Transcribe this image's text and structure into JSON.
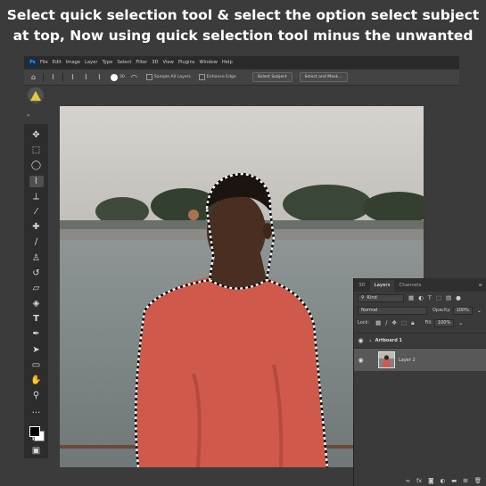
{
  "caption": {
    "line1": "Select quick selection tool & select the option select subject",
    "line2": "at top, Now using quick selection tool minus the unwanted"
  },
  "menubar": {
    "logo": "Ps",
    "items": [
      "File",
      "Edit",
      "Image",
      "Layer",
      "Type",
      "Select",
      "Filter",
      "3D",
      "View",
      "Plugins",
      "Window",
      "Help"
    ]
  },
  "options_bar": {
    "brush_size": "30",
    "sample_all_layers": "Sample All Layers",
    "enhance_edge": "Enhance Edge",
    "select_subject": "Select Subject",
    "select_and_mask": "Select and Mask..."
  },
  "layers_panel": {
    "tabs": [
      "3D",
      "Layers",
      "Channels"
    ],
    "active_tab": "Layers",
    "filter_kind": "Kind",
    "blend_mode": "Normal",
    "opacity_label": "Opacity:",
    "opacity_value": "100%",
    "lock_label": "Lock:",
    "fill_label": "Fill:",
    "fill_value": "100%",
    "layers": [
      {
        "name": "Artboard 1"
      },
      {
        "name": "Layer 2"
      }
    ]
  },
  "colors": {
    "shirt": "#cf5a4b",
    "selection_ants": "#ffffff",
    "ui_bg": "#3b3b3b",
    "panel_bg": "#3a3a3a",
    "active_layer": "#585858"
  }
}
